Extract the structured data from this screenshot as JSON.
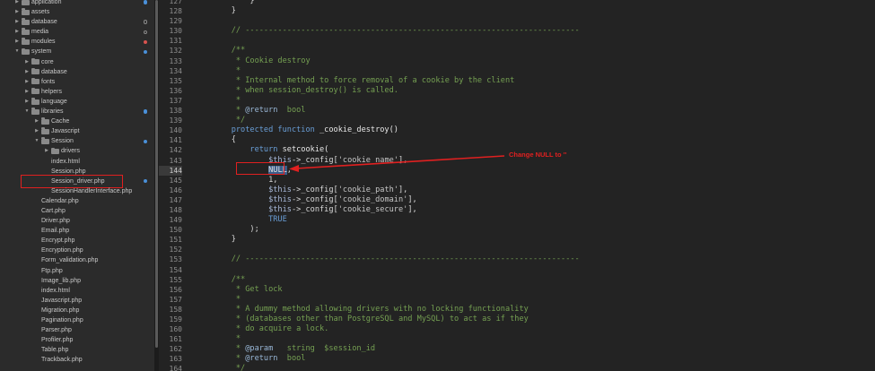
{
  "sidebar": {
    "rows": [
      {
        "indent": 0,
        "type": "folder",
        "label": "application",
        "expanded": false,
        "dot": "blue"
      },
      {
        "indent": 0,
        "type": "folder",
        "label": "assets",
        "expanded": false,
        "dot": ""
      },
      {
        "indent": 0,
        "type": "folder",
        "label": "database",
        "expanded": false,
        "dot": "hollow"
      },
      {
        "indent": 0,
        "type": "folder",
        "label": "media",
        "expanded": false,
        "dot": "hollow"
      },
      {
        "indent": 0,
        "type": "folder",
        "label": "modules",
        "expanded": false,
        "dot": "red"
      },
      {
        "indent": 0,
        "type": "folder",
        "label": "system",
        "expanded": true,
        "dot": "blue"
      },
      {
        "indent": 1,
        "type": "folder",
        "label": "core",
        "expanded": false,
        "dot": ""
      },
      {
        "indent": 1,
        "type": "folder",
        "label": "database",
        "expanded": false,
        "dot": ""
      },
      {
        "indent": 1,
        "type": "folder",
        "label": "fonts",
        "expanded": false,
        "dot": ""
      },
      {
        "indent": 1,
        "type": "folder",
        "label": "helpers",
        "expanded": false,
        "dot": ""
      },
      {
        "indent": 1,
        "type": "folder",
        "label": "language",
        "expanded": false,
        "dot": ""
      },
      {
        "indent": 1,
        "type": "folder",
        "label": "libraries",
        "expanded": true,
        "dot": "blue"
      },
      {
        "indent": 2,
        "type": "folder",
        "label": "Cache",
        "expanded": false,
        "dot": ""
      },
      {
        "indent": 2,
        "type": "folder",
        "label": "Javascript",
        "expanded": false,
        "dot": ""
      },
      {
        "indent": 2,
        "type": "folder",
        "label": "Session",
        "expanded": true,
        "dot": "blue"
      },
      {
        "indent": 3,
        "type": "folder",
        "label": "drivers",
        "expanded": false,
        "dot": ""
      },
      {
        "indent": 3,
        "type": "file",
        "label": "index.html",
        "dot": ""
      },
      {
        "indent": 3,
        "type": "file",
        "label": "Session.php",
        "dot": ""
      },
      {
        "indent": 3,
        "type": "file",
        "label": "Session_driver.php",
        "dot": "blue",
        "selected": true
      },
      {
        "indent": 3,
        "type": "file",
        "label": "SessionHandlerInterface.php",
        "dot": ""
      },
      {
        "indent": 2,
        "type": "file",
        "label": "Calendar.php",
        "dot": ""
      },
      {
        "indent": 2,
        "type": "file",
        "label": "Cart.php",
        "dot": ""
      },
      {
        "indent": 2,
        "type": "file",
        "label": "Driver.php",
        "dot": ""
      },
      {
        "indent": 2,
        "type": "file",
        "label": "Email.php",
        "dot": ""
      },
      {
        "indent": 2,
        "type": "file",
        "label": "Encrypt.php",
        "dot": ""
      },
      {
        "indent": 2,
        "type": "file",
        "label": "Encryption.php",
        "dot": ""
      },
      {
        "indent": 2,
        "type": "file",
        "label": "Form_validation.php",
        "dot": ""
      },
      {
        "indent": 2,
        "type": "file",
        "label": "Ftp.php",
        "dot": ""
      },
      {
        "indent": 2,
        "type": "file",
        "label": "Image_lib.php",
        "dot": ""
      },
      {
        "indent": 2,
        "type": "file",
        "label": "index.html",
        "dot": ""
      },
      {
        "indent": 2,
        "type": "file",
        "label": "Javascript.php",
        "dot": ""
      },
      {
        "indent": 2,
        "type": "file",
        "label": "Migration.php",
        "dot": ""
      },
      {
        "indent": 2,
        "type": "file",
        "label": "Pagination.php",
        "dot": ""
      },
      {
        "indent": 2,
        "type": "file",
        "label": "Parser.php",
        "dot": ""
      },
      {
        "indent": 2,
        "type": "file",
        "label": "Profiler.php",
        "dot": ""
      },
      {
        "indent": 2,
        "type": "file",
        "label": "Table.php",
        "dot": ""
      },
      {
        "indent": 2,
        "type": "file",
        "label": "Trackback.php",
        "dot": ""
      }
    ]
  },
  "editor": {
    "current_line": "144",
    "lines": [
      {
        "n": "127",
        "t": [
          [
            "",
            "        }"
          ]
        ]
      },
      {
        "n": "128",
        "t": [
          [
            "",
            "    }"
          ]
        ]
      },
      {
        "n": "129",
        "t": [
          [
            "",
            ""
          ]
        ]
      },
      {
        "n": "130",
        "t": [
          [
            "comment",
            "    // ------------------------------------------------------------------------"
          ]
        ]
      },
      {
        "n": "131",
        "t": [
          [
            "",
            ""
          ]
        ]
      },
      {
        "n": "132",
        "t": [
          [
            "comment",
            "    /**"
          ]
        ]
      },
      {
        "n": "133",
        "t": [
          [
            "comment",
            "     * Cookie destroy"
          ]
        ]
      },
      {
        "n": "134",
        "t": [
          [
            "comment",
            "     *"
          ]
        ]
      },
      {
        "n": "135",
        "t": [
          [
            "comment",
            "     * Internal method to force removal of a cookie by the client"
          ]
        ]
      },
      {
        "n": "136",
        "t": [
          [
            "comment",
            "     * when session_destroy() is called."
          ]
        ]
      },
      {
        "n": "137",
        "t": [
          [
            "comment",
            "     *"
          ]
        ]
      },
      {
        "n": "138",
        "t": [
          [
            "comment",
            "     * "
          ],
          [
            "tag",
            "@return"
          ],
          [
            "comment",
            "  bool"
          ]
        ]
      },
      {
        "n": "139",
        "t": [
          [
            "comment",
            "     */"
          ]
        ]
      },
      {
        "n": "140",
        "t": [
          [
            "kw",
            "    protected function "
          ],
          [
            "func",
            "_cookie_destroy()"
          ]
        ]
      },
      {
        "n": "141",
        "t": [
          [
            "",
            "    {"
          ]
        ]
      },
      {
        "n": "142",
        "t": [
          [
            "kw",
            "        return "
          ],
          [
            "func",
            "setcookie("
          ]
        ]
      },
      {
        "n": "143",
        "t": [
          [
            "var",
            "            $this"
          ],
          [
            "",
            "->_config["
          ],
          [
            "str",
            "'cookie_name'"
          ],
          [
            "",
            "],"
          ]
        ]
      },
      {
        "n": "144",
        "t": [
          [
            "",
            "            "
          ],
          [
            "null",
            "NULL"
          ],
          [
            "",
            ","
          ]
        ]
      },
      {
        "n": "145",
        "t": [
          [
            "",
            "            1,"
          ]
        ]
      },
      {
        "n": "146",
        "t": [
          [
            "var",
            "            $this"
          ],
          [
            "",
            "->_config["
          ],
          [
            "str",
            "'cookie_path'"
          ],
          [
            "",
            "],"
          ]
        ]
      },
      {
        "n": "147",
        "t": [
          [
            "var",
            "            $this"
          ],
          [
            "",
            "->_config["
          ],
          [
            "str",
            "'cookie_domain'"
          ],
          [
            "",
            "],"
          ]
        ]
      },
      {
        "n": "148",
        "t": [
          [
            "var",
            "            $this"
          ],
          [
            "",
            "->_config["
          ],
          [
            "str",
            "'cookie_secure'"
          ],
          [
            "",
            "],"
          ]
        ]
      },
      {
        "n": "149",
        "t": [
          [
            "const",
            "            TRUE"
          ]
        ]
      },
      {
        "n": "150",
        "t": [
          [
            "",
            "        );"
          ]
        ]
      },
      {
        "n": "151",
        "t": [
          [
            "",
            "    }"
          ]
        ]
      },
      {
        "n": "152",
        "t": [
          [
            "",
            ""
          ]
        ]
      },
      {
        "n": "153",
        "t": [
          [
            "comment",
            "    // ------------------------------------------------------------------------"
          ]
        ]
      },
      {
        "n": "154",
        "t": [
          [
            "",
            ""
          ]
        ]
      },
      {
        "n": "155",
        "t": [
          [
            "comment",
            "    /**"
          ]
        ]
      },
      {
        "n": "156",
        "t": [
          [
            "comment",
            "     * Get lock"
          ]
        ]
      },
      {
        "n": "157",
        "t": [
          [
            "comment",
            "     *"
          ]
        ]
      },
      {
        "n": "158",
        "t": [
          [
            "comment",
            "     * A dummy method allowing drivers with no locking functionality"
          ]
        ]
      },
      {
        "n": "159",
        "t": [
          [
            "comment",
            "     * (databases other than PostgreSQL and MySQL) to act as if they"
          ]
        ]
      },
      {
        "n": "160",
        "t": [
          [
            "comment",
            "     * do acquire a lock."
          ]
        ]
      },
      {
        "n": "161",
        "t": [
          [
            "comment",
            "     *"
          ]
        ]
      },
      {
        "n": "162",
        "t": [
          [
            "comment",
            "     * "
          ],
          [
            "tag",
            "@param"
          ],
          [
            "comment",
            "   string  $session_id"
          ]
        ]
      },
      {
        "n": "163",
        "t": [
          [
            "comment",
            "     * "
          ],
          [
            "tag",
            "@return"
          ],
          [
            "comment",
            "  bool"
          ]
        ]
      },
      {
        "n": "164",
        "t": [
          [
            "comment",
            "     */"
          ]
        ]
      }
    ]
  },
  "annotation": {
    "text": "Change NULL to ''",
    "color": "#e02020"
  }
}
